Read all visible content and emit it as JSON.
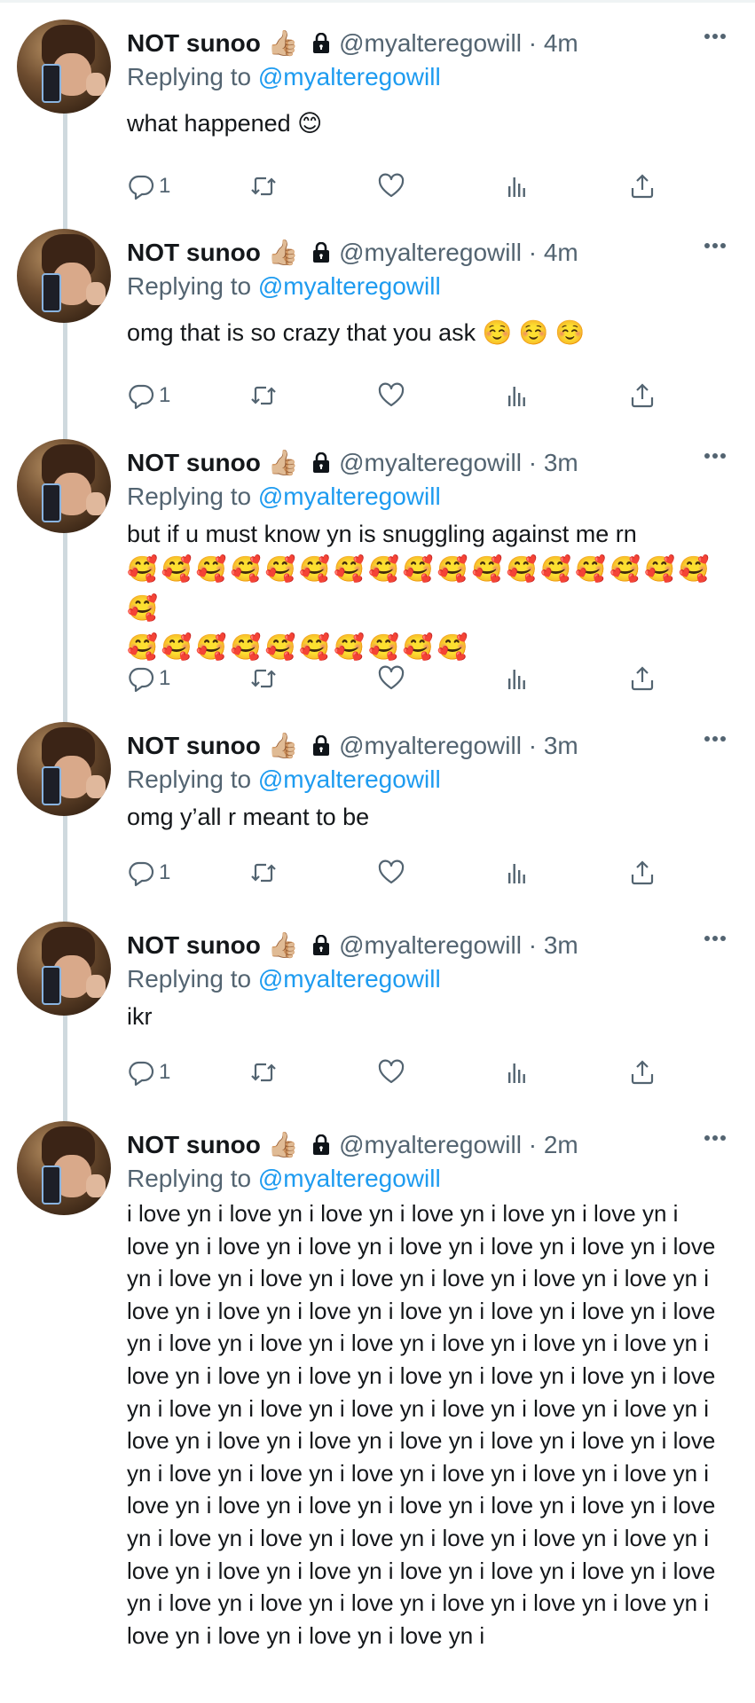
{
  "author": {
    "display_name": "NOT sunoo",
    "display_emoji": "👍🏼",
    "handle": "@myalteregowill",
    "separator": "·"
  },
  "reply_prefix": "Replying to",
  "reply_handle": "@myalteregowill",
  "icons": {
    "reply": "reply-icon",
    "retweet": "retweet-icon",
    "like": "heart-icon",
    "views": "views-icon",
    "share": "share-icon",
    "more": "more-icon",
    "lock": "lock-icon"
  },
  "colors": {
    "link": "#1d9bf0",
    "meta": "#536471",
    "text": "#14171a"
  },
  "tweets": [
    {
      "time": "4m",
      "text": "what happened 😊",
      "reply_count": "1"
    },
    {
      "time": "4m",
      "text": "omg that is so crazy that you ask ☺️ ☺️ ☺️",
      "reply_count": "1"
    },
    {
      "time": "3m",
      "text": "but if u must know yn is snuggling against me rn",
      "emoji_line_1": "🥰🥰🥰🥰🥰🥰🥰🥰🥰🥰🥰🥰🥰🥰🥰🥰🥰🥰",
      "emoji_line_2": "🥰🥰🥰🥰🥰🥰🥰🥰🥰🥰",
      "reply_count": "1"
    },
    {
      "time": "3m",
      "text": "omg y’all r meant to be",
      "reply_count": "1"
    },
    {
      "time": "3m",
      "text": "ikr",
      "reply_count": "1"
    },
    {
      "time": "2m",
      "text": "i love yn i love yn i love yn i love yn i love yn i love yn i love yn i love yn i love yn i love yn i love yn i love yn i love yn i love yn  i love yn i love yn i love yn i love yn i love yn i love yn i love yn i love yn i love yn i love yn i love yn i love yn i love yn i love yn  i love yn i love yn i love yn i love yn i love yn i love yn i love yn i love yn i love yn i love yn i love yn i love yn i love yn i love yn i love yn  i love yn i love yn i love yn i love yn i love yn i love yn i love yn i love yn i love yn i love yn i love yn i love yn i love yn i love yn i love yn i love yn i love yn  i love yn i love yn i love yn i love yn i love yn i love yn i love yn i love yn i love yn i love yn i love yn i love yn  i love yn i love yn i love yn i love yn i love yn i love yn i love yn i love yn i love yn i love yn i love yn  i love yn i love yn i love yn i love yn i love yn i"
    }
  ]
}
